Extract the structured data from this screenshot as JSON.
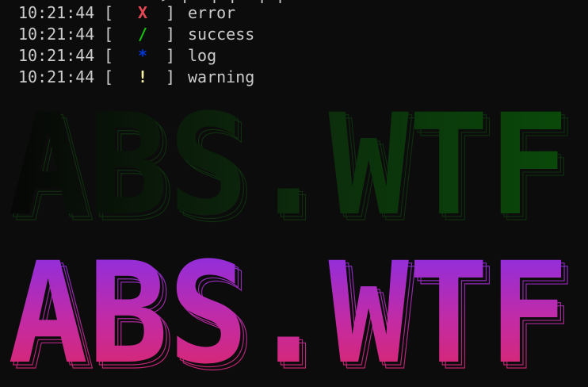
{
  "terminal": {
    "cut_top_text": "               > [  ] [  ] [   ",
    "log_lines": [
      {
        "time": "10:21:44",
        "open": "[",
        "symbol": "X",
        "close": "]",
        "message": "error",
        "color": "#e74856"
      },
      {
        "time": "10:21:44",
        "open": "[",
        "symbol": "/",
        "close": "]",
        "message": "success",
        "color": "#16c60c"
      },
      {
        "time": "10:21:44",
        "open": "[",
        "symbol": "*",
        "close": "]",
        "message": "log",
        "color": "#0037da"
      },
      {
        "time": "10:21:44",
        "open": "[",
        "symbol": "!",
        "close": "]",
        "message": "warning",
        "color": "#f9f1a5"
      }
    ],
    "banner_text": "ABS.WTF",
    "banners": [
      {
        "style": "dark-gradient",
        "colors": [
          "#0a0a0a",
          "#0f2a0f",
          "#0a4a0a"
        ]
      },
      {
        "style": "purple-pink-gradient",
        "colors": [
          "#7f2ff0",
          "#c42ba3",
          "#e0245a"
        ]
      }
    ]
  }
}
